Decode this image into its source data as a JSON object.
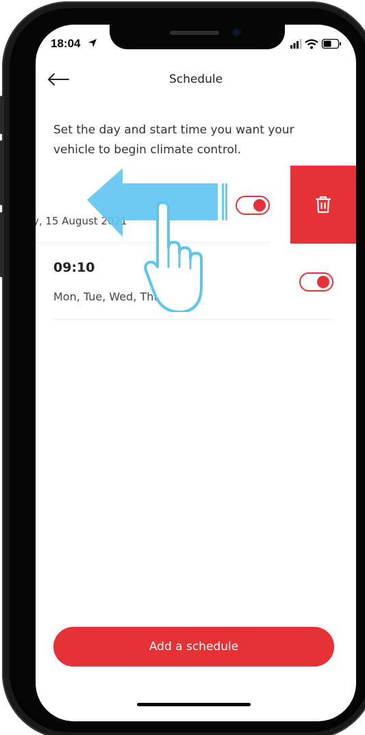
{
  "status_bar": {
    "time": "18:04"
  },
  "header": {
    "title": "Schedule"
  },
  "description": "Set the day and start time you want your vehicle to begin climate control.",
  "schedules": [
    {
      "time": "",
      "date": "y, 15 August 2021",
      "enabled": true,
      "swiped": true
    },
    {
      "time": "09:10",
      "days": "Mon, Tue, Wed, Thu, Fri",
      "enabled": true,
      "swiped": false
    }
  ],
  "add_button": {
    "label": "Add a schedule"
  },
  "colors": {
    "accent": "#e63136",
    "gesture": "#5ec4f2"
  },
  "icons": {
    "back": "arrow-left-icon",
    "delete": "trash-icon",
    "location": "location-arrow-icon",
    "signal": "signal-icon",
    "wifi": "wifi-icon",
    "battery": "battery-icon",
    "swipe_arrow": "swipe-left-arrow-icon",
    "hand": "hand-pointer-icon"
  }
}
